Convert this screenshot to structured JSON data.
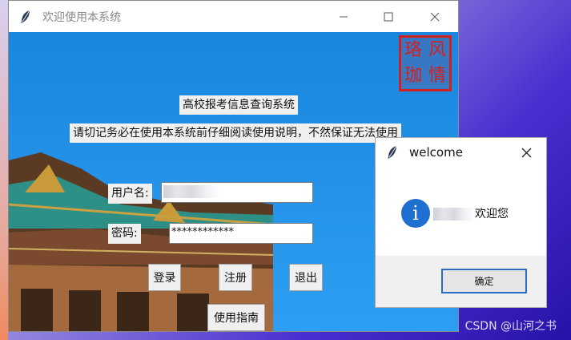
{
  "main_window": {
    "title": "欢迎使用本系统",
    "seal_chars": [
      "风",
      "珞",
      "情",
      "珈"
    ],
    "heading": "高校报考信息查询系统",
    "notice": "请切记务必在使用本系统前仔细阅读使用说明，不然保证无法使用",
    "username_label": "用户名:",
    "password_label": "密码:",
    "password_value": "************",
    "buttons": {
      "login": "登录",
      "register": "注册",
      "exit": "退出",
      "guide": "使用指南"
    }
  },
  "dialog": {
    "title": "welcome",
    "message_suffix": "欢迎您",
    "ok_label": "确定"
  },
  "watermark": "CSDN @山河之书",
  "colors": {
    "window_bg_blue": "#1e90e6",
    "seal_red": "#d12020",
    "info_blue": "#1f6fd0",
    "focus_blue": "#2a6bc8"
  }
}
